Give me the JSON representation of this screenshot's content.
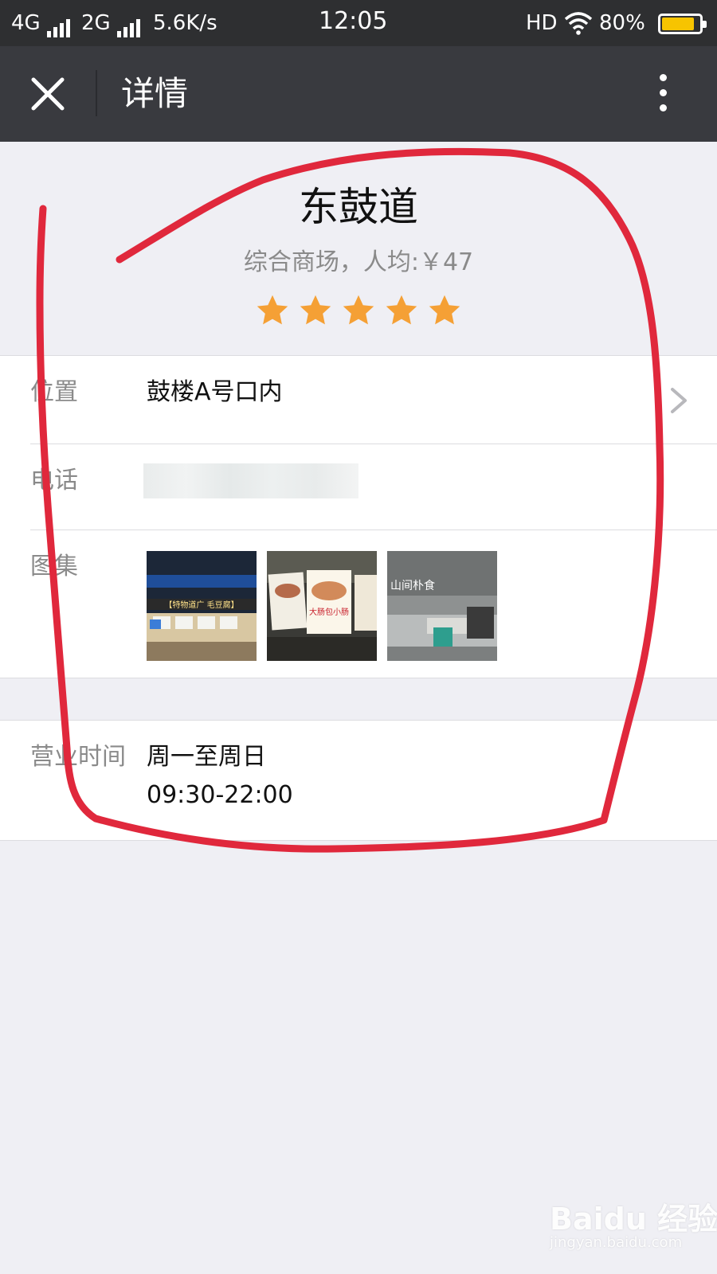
{
  "status_bar": {
    "network1": "4G",
    "network2": "2G",
    "speed": "5.6K/s",
    "time": "12:05",
    "hd": "HD",
    "battery_level": 80,
    "battery_text": "80%"
  },
  "nav": {
    "title": "详情",
    "close_icon": "close-icon",
    "more_icon": "more-vertical-icon"
  },
  "shop": {
    "name": "东鼓道",
    "subtitle": "综合商场，人均:￥47",
    "rating": 5,
    "star_color": "#f5a035"
  },
  "details": {
    "location_label": "位置",
    "location_value": "鼓楼A号口内",
    "phone_label": "电话",
    "gallery_label": "图集",
    "gallery_images": [
      {
        "name": "storefront-photo",
        "sign": "【特物道广 毛豆腐】"
      },
      {
        "name": "menu-board-photo",
        "sign": "大肠包小肠"
      },
      {
        "name": "shop-counter-photo",
        "sign": "山间朴食"
      }
    ],
    "hours_label": "营业时间",
    "hours_days": "周一至周日",
    "hours_time": "09:30-22:00"
  },
  "watermark": {
    "main": "Baidu 经验",
    "sub": "jingyan.baidu.com"
  },
  "colors": {
    "status_bar": "#2e2f31",
    "nav_bar": "#393a3f",
    "background": "#efeff4",
    "annotation": "#e0283c",
    "star": "#f5a035"
  }
}
